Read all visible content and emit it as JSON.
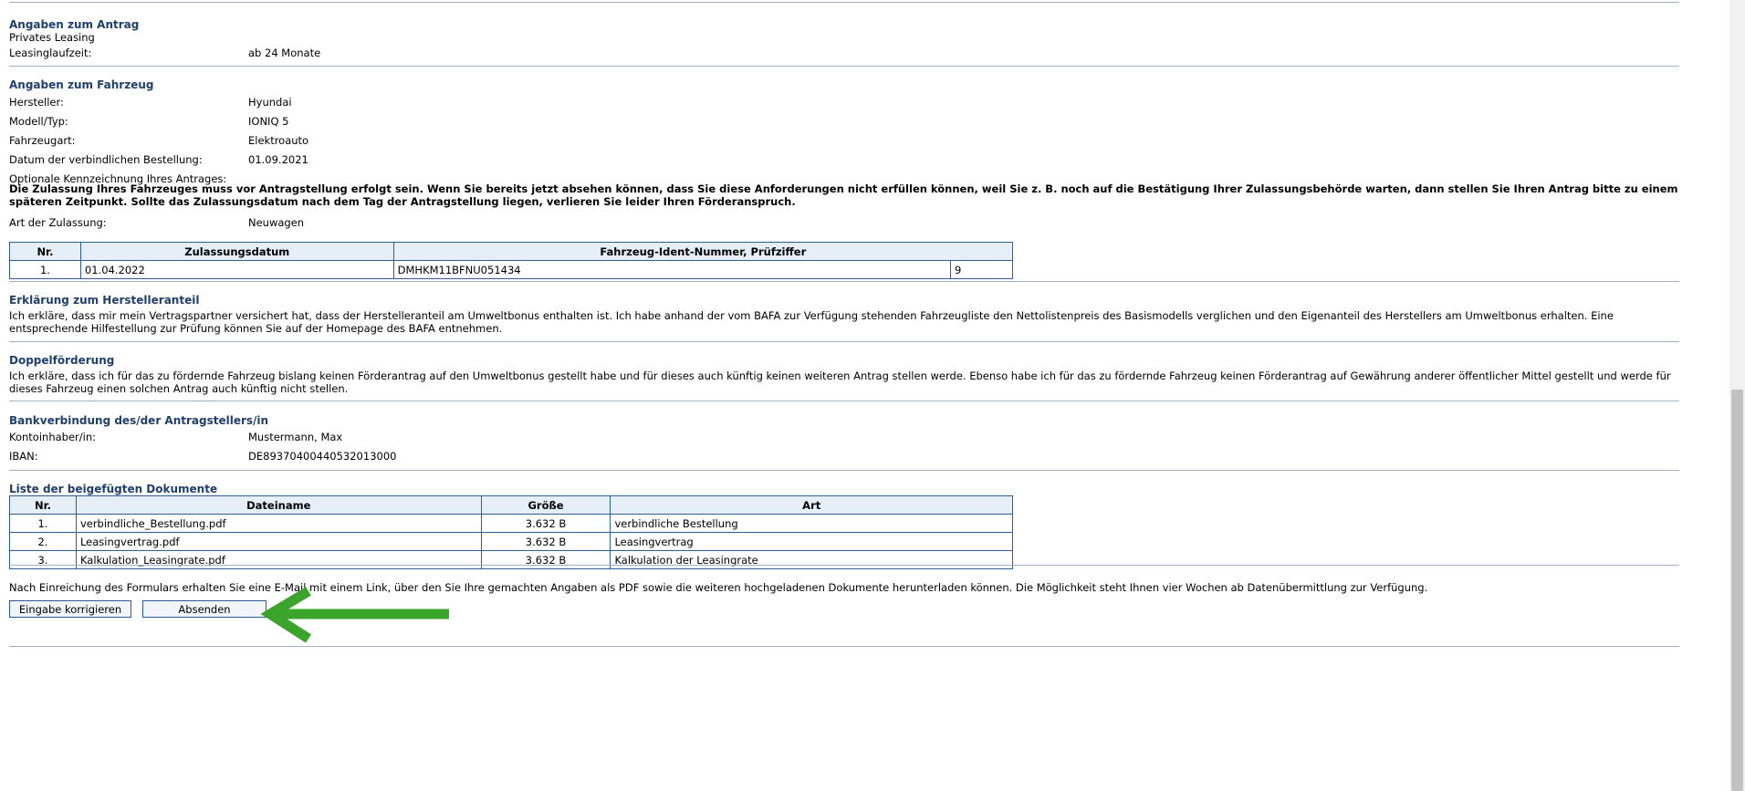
{
  "antrag": {
    "title": "Angaben zum Antrag",
    "type": "Privates Leasing",
    "laufzeit_label": "Leasinglaufzeit:",
    "laufzeit_value": "ab 24 Monate"
  },
  "fahrzeug": {
    "title": "Angaben zum Fahrzeug",
    "hersteller_label": "Hersteller:",
    "hersteller_value": "Hyundai",
    "modell_label": "Modell/Typ:",
    "modell_value": "IONIQ 5",
    "art_label": "Fahrzeugart:",
    "art_value": "Elektroauto",
    "datum_label": "Datum der verbindlichen Bestellung:",
    "datum_value": "01.09.2021",
    "kennzeichnung_label": "Optionale Kennzeichnung Ihres Antrages:",
    "warning": "Die Zulassung Ihres Fahrzeuges muss vor Antragstellung erfolgt sein. Wenn Sie bereits jetzt absehen können, dass Sie diese Anforderungen nicht erfüllen können, weil Sie z. B. noch auf die Bestätigung Ihrer Zulassungsbehörde warten, dann stellen Sie Ihren Antrag bitte zu einem späteren Zeitpunkt. Sollte das Zulassungsdatum nach dem Tag der Antragstellung liegen, verlieren Sie leider Ihren Förderanspruch.",
    "zulassung_label": "Art der Zulassung:",
    "zulassung_value": "Neuwagen"
  },
  "zulassung_table": {
    "headers": [
      "Nr.",
      "Zulassungsdatum",
      "Fahrzeug-Ident-Nummer, Prüfziffer"
    ],
    "rows": [
      {
        "nr": "1.",
        "datum": "01.04.2022",
        "fin": "DMHKM11BFNU051434",
        "pruefziffer": "9"
      }
    ]
  },
  "herstelleranteil": {
    "title": "Erklärung zum Herstelleranteil",
    "text": "Ich erkläre, dass mir mein Vertragspartner versichert hat, dass der Herstelleranteil am Umweltbonus enthalten ist. Ich habe anhand der vom BAFA zur Verfügung stehenden Fahrzeugliste den Nettolistenpreis des Basismodells verglichen und den Eigenanteil des Herstellers am Umweltbonus erhalten. Eine entsprechende Hilfestellung zur Prüfung können Sie auf der Homepage des BAFA entnehmen."
  },
  "doppelfoerderung": {
    "title": "Doppelförderung",
    "text": "Ich erkläre, dass ich für das zu fördernde Fahrzeug bislang keinen Förderantrag auf den Umweltbonus gestellt habe und für dieses auch künftig keinen weiteren Antrag stellen werde. Ebenso habe ich für das zu fördernde Fahrzeug keinen Förderantrag auf Gewährung anderer öffentlicher Mittel gestellt und werde für dieses Fahrzeug einen solchen Antrag auch künftig nicht stellen."
  },
  "bank": {
    "title": "Bankverbindung des/der Antragstellers/in",
    "inhaber_label": "Kontoinhaber/in:",
    "inhaber_value": "Mustermann, Max",
    "iban_label": "IBAN:",
    "iban_value": "DE89370400440532013000"
  },
  "dokumente": {
    "title": "Liste der beigefügten Dokumente",
    "headers": [
      "Nr.",
      "Dateiname",
      "Größe",
      "Art"
    ],
    "rows": [
      {
        "nr": "1.",
        "name": "verbindliche_Bestellung.pdf",
        "size": "3.632 B",
        "art": "verbindliche Bestellung"
      },
      {
        "nr": "2.",
        "name": "Leasingvertrag.pdf",
        "size": "3.632 B",
        "art": "Leasingvertrag"
      },
      {
        "nr": "3.",
        "name": "Kalkulation_Leasingrate.pdf",
        "size": "3.632 B",
        "art": "Kalkulation der Leasingrate"
      }
    ]
  },
  "footer": {
    "note": "Nach Einreichung des Formulars erhalten Sie eine E-Mail mit einem Link, über den Sie Ihre gemachten Angaben als PDF sowie die weiteren hochgeladenen Dokumente herunterladen können. Die Möglichkeit steht Ihnen vier Wochen ab Datenübermittlung zur Verfügung.",
    "correct_label": "Eingabe korrigieren",
    "submit_label": "Absenden"
  },
  "colors": {
    "heading": "#1f3f6e",
    "table_border": "#2f5d9a",
    "annotation_arrow": "#3aa52a"
  },
  "icons": {
    "annotation": "arrow-left-icon"
  }
}
